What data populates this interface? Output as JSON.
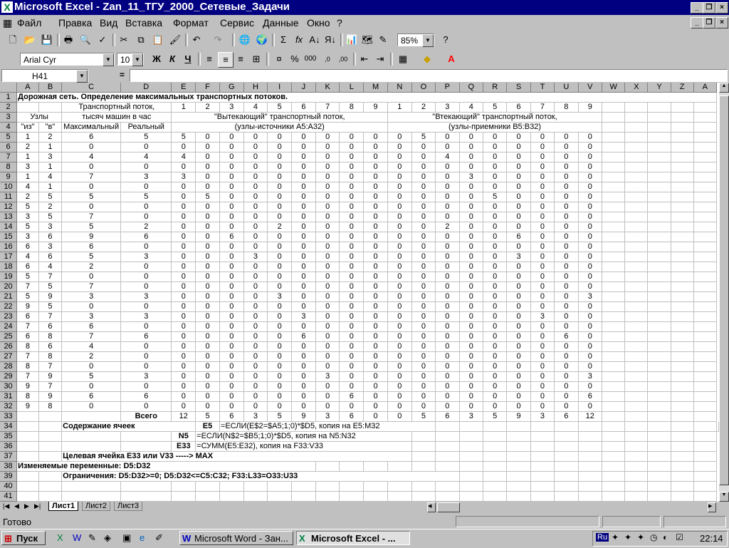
{
  "window": {
    "title": "Microsoft Excel - Zan_11_ТГУ_2000_Сетевые_Задачи",
    "icon": "excel-icon"
  },
  "menu": [
    "Файл",
    "Правка",
    "Вид",
    "Вставка",
    "Формат",
    "Сервис",
    "Данные",
    "Окно",
    "?"
  ],
  "toolbar": {
    "zoom": "85%",
    "font": "Arial Cyr",
    "size": "10",
    "bold": "Ж",
    "italic": "К",
    "underline": "Ч"
  },
  "formula": {
    "namebox": "H41",
    "eq": "=",
    "content": ""
  },
  "columns": [
    "A",
    "B",
    "C",
    "D",
    "E",
    "F",
    "G",
    "H",
    "I",
    "J",
    "K",
    "L",
    "M",
    "N",
    "O",
    "P",
    "Q",
    "R",
    "S",
    "T",
    "U",
    "V",
    "W",
    "X",
    "Y",
    "Z",
    "A"
  ],
  "header": {
    "title": "Дорожная сеть. Определение максимальных транспортных потоков.",
    "flow": "Транспортный поток,",
    "flow2": "тысяч машин в час",
    "nodes": "Узлы",
    "from": "\"из\"",
    "to": "\"в\"",
    "max": "Максимальный",
    "real": "Реальный",
    "out1": "\"Вытекающий\" транспортный поток,",
    "out2": "(узлы-источники A5:A32)",
    "in1": "\"Втекающий\" транспортный поток,",
    "in2": "(узлы-приемники B5:B32)",
    "nums": [
      "1",
      "2",
      "3",
      "4",
      "5",
      "6",
      "7",
      "8",
      "9"
    ]
  },
  "rows": [
    [
      "1",
      "2",
      "6",
      "5",
      "5",
      "0",
      "0",
      "0",
      "0",
      "0",
      "0",
      "0",
      "0",
      "0",
      "5",
      "0",
      "0",
      "0",
      "0",
      "0",
      "0",
      "0"
    ],
    [
      "2",
      "1",
      "0",
      "0",
      "0",
      "0",
      "0",
      "0",
      "0",
      "0",
      "0",
      "0",
      "0",
      "0",
      "0",
      "0",
      "0",
      "0",
      "0",
      "0",
      "0",
      "0"
    ],
    [
      "1",
      "3",
      "4",
      "4",
      "4",
      "0",
      "0",
      "0",
      "0",
      "0",
      "0",
      "0",
      "0",
      "0",
      "0",
      "4",
      "0",
      "0",
      "0",
      "0",
      "0",
      "0"
    ],
    [
      "3",
      "1",
      "0",
      "0",
      "0",
      "0",
      "0",
      "0",
      "0",
      "0",
      "0",
      "0",
      "0",
      "0",
      "0",
      "0",
      "0",
      "0",
      "0",
      "0",
      "0",
      "0"
    ],
    [
      "1",
      "4",
      "7",
      "3",
      "3",
      "0",
      "0",
      "0",
      "0",
      "0",
      "0",
      "0",
      "0",
      "0",
      "0",
      "0",
      "3",
      "0",
      "0",
      "0",
      "0",
      "0"
    ],
    [
      "4",
      "1",
      "0",
      "0",
      "0",
      "0",
      "0",
      "0",
      "0",
      "0",
      "0",
      "0",
      "0",
      "0",
      "0",
      "0",
      "0",
      "0",
      "0",
      "0",
      "0",
      "0"
    ],
    [
      "2",
      "5",
      "5",
      "5",
      "0",
      "5",
      "0",
      "0",
      "0",
      "0",
      "0",
      "0",
      "0",
      "0",
      "0",
      "0",
      "0",
      "5",
      "0",
      "0",
      "0",
      "0"
    ],
    [
      "5",
      "2",
      "0",
      "0",
      "0",
      "0",
      "0",
      "0",
      "0",
      "0",
      "0",
      "0",
      "0",
      "0",
      "0",
      "0",
      "0",
      "0",
      "0",
      "0",
      "0",
      "0"
    ],
    [
      "3",
      "5",
      "7",
      "0",
      "0",
      "0",
      "0",
      "0",
      "0",
      "0",
      "0",
      "0",
      "0",
      "0",
      "0",
      "0",
      "0",
      "0",
      "0",
      "0",
      "0",
      "0"
    ],
    [
      "5",
      "3",
      "5",
      "2",
      "0",
      "0",
      "0",
      "0",
      "2",
      "0",
      "0",
      "0",
      "0",
      "0",
      "0",
      "2",
      "0",
      "0",
      "0",
      "0",
      "0",
      "0"
    ],
    [
      "3",
      "6",
      "9",
      "6",
      "0",
      "0",
      "6",
      "0",
      "0",
      "0",
      "0",
      "0",
      "0",
      "0",
      "0",
      "0",
      "0",
      "0",
      "6",
      "0",
      "0",
      "0"
    ],
    [
      "6",
      "3",
      "6",
      "0",
      "0",
      "0",
      "0",
      "0",
      "0",
      "0",
      "0",
      "0",
      "0",
      "0",
      "0",
      "0",
      "0",
      "0",
      "0",
      "0",
      "0",
      "0"
    ],
    [
      "4",
      "6",
      "5",
      "3",
      "0",
      "0",
      "0",
      "3",
      "0",
      "0",
      "0",
      "0",
      "0",
      "0",
      "0",
      "0",
      "0",
      "0",
      "3",
      "0",
      "0",
      "0"
    ],
    [
      "6",
      "4",
      "2",
      "0",
      "0",
      "0",
      "0",
      "0",
      "0",
      "0",
      "0",
      "0",
      "0",
      "0",
      "0",
      "0",
      "0",
      "0",
      "0",
      "0",
      "0",
      "0"
    ],
    [
      "5",
      "7",
      "0",
      "0",
      "0",
      "0",
      "0",
      "0",
      "0",
      "0",
      "0",
      "0",
      "0",
      "0",
      "0",
      "0",
      "0",
      "0",
      "0",
      "0",
      "0",
      "0"
    ],
    [
      "7",
      "5",
      "7",
      "0",
      "0",
      "0",
      "0",
      "0",
      "0",
      "0",
      "0",
      "0",
      "0",
      "0",
      "0",
      "0",
      "0",
      "0",
      "0",
      "0",
      "0",
      "0"
    ],
    [
      "5",
      "9",
      "3",
      "3",
      "0",
      "0",
      "0",
      "0",
      "3",
      "0",
      "0",
      "0",
      "0",
      "0",
      "0",
      "0",
      "0",
      "0",
      "0",
      "0",
      "0",
      "3"
    ],
    [
      "9",
      "5",
      "0",
      "0",
      "0",
      "0",
      "0",
      "0",
      "0",
      "0",
      "0",
      "0",
      "0",
      "0",
      "0",
      "0",
      "0",
      "0",
      "0",
      "0",
      "0",
      "0"
    ],
    [
      "6",
      "7",
      "3",
      "3",
      "0",
      "0",
      "0",
      "0",
      "0",
      "3",
      "0",
      "0",
      "0",
      "0",
      "0",
      "0",
      "0",
      "0",
      "0",
      "3",
      "0",
      "0"
    ],
    [
      "7",
      "6",
      "6",
      "0",
      "0",
      "0",
      "0",
      "0",
      "0",
      "0",
      "0",
      "0",
      "0",
      "0",
      "0",
      "0",
      "0",
      "0",
      "0",
      "0",
      "0",
      "0"
    ],
    [
      "6",
      "8",
      "7",
      "6",
      "0",
      "0",
      "0",
      "0",
      "0",
      "6",
      "0",
      "0",
      "0",
      "0",
      "0",
      "0",
      "0",
      "0",
      "0",
      "0",
      "6",
      "0"
    ],
    [
      "8",
      "6",
      "4",
      "0",
      "0",
      "0",
      "0",
      "0",
      "0",
      "0",
      "0",
      "0",
      "0",
      "0",
      "0",
      "0",
      "0",
      "0",
      "0",
      "0",
      "0",
      "0"
    ],
    [
      "7",
      "8",
      "2",
      "0",
      "0",
      "0",
      "0",
      "0",
      "0",
      "0",
      "0",
      "0",
      "0",
      "0",
      "0",
      "0",
      "0",
      "0",
      "0",
      "0",
      "0",
      "0"
    ],
    [
      "8",
      "7",
      "0",
      "0",
      "0",
      "0",
      "0",
      "0",
      "0",
      "0",
      "0",
      "0",
      "0",
      "0",
      "0",
      "0",
      "0",
      "0",
      "0",
      "0",
      "0",
      "0"
    ],
    [
      "7",
      "9",
      "5",
      "3",
      "0",
      "0",
      "0",
      "0",
      "0",
      "0",
      "3",
      "0",
      "0",
      "0",
      "0",
      "0",
      "0",
      "0",
      "0",
      "0",
      "0",
      "3"
    ],
    [
      "9",
      "7",
      "0",
      "0",
      "0",
      "0",
      "0",
      "0",
      "0",
      "0",
      "0",
      "0",
      "0",
      "0",
      "0",
      "0",
      "0",
      "0",
      "0",
      "0",
      "0",
      "0"
    ],
    [
      "8",
      "9",
      "6",
      "6",
      "0",
      "0",
      "0",
      "0",
      "0",
      "0",
      "0",
      "6",
      "0",
      "0",
      "0",
      "0",
      "0",
      "0",
      "0",
      "0",
      "0",
      "6"
    ],
    [
      "9",
      "8",
      "0",
      "0",
      "0",
      "0",
      "0",
      "0",
      "0",
      "0",
      "0",
      "0",
      "0",
      "0",
      "0",
      "0",
      "0",
      "0",
      "0",
      "0",
      "0",
      "0"
    ]
  ],
  "totals": {
    "label": "Всего",
    "values": [
      "12",
      "5",
      "6",
      "3",
      "5",
      "9",
      "3",
      "6",
      "0",
      "0",
      "5",
      "6",
      "3",
      "5",
      "9",
      "3",
      "6",
      "12"
    ]
  },
  "notes": {
    "cells_label": "Содержание ячеек",
    "e5": "E5",
    "e5f": "=ЕСЛИ(E$2=$A5;1;0)*$D5,  копия на E5:M32",
    "n5": "N5",
    "n5f": "=ЕСЛИ(N$2=$B5;1;0)*$D5,  копия на N5:N32",
    "e33": "E33",
    "e33f": "=СУММ(E5:E32),  копия на F33:V33",
    "target": "Целевая ячейка     E33  или   V33    -----> MAX",
    "vars": "Изменяемые переменные:   D5:D32",
    "constraints": "Ограничения:  D5:D32>=0;    D5:D32<=C5:C32;     F33:L33=O33:U33"
  },
  "sheets": [
    "Лист1",
    "Лист2",
    "Лист3"
  ],
  "status": "Готово",
  "taskbar": {
    "start": "Пуск",
    "word": "Microsoft Word - Зан...",
    "excel": "Microsoft Excel - ...",
    "lang": "Ru",
    "time": "22:14"
  }
}
